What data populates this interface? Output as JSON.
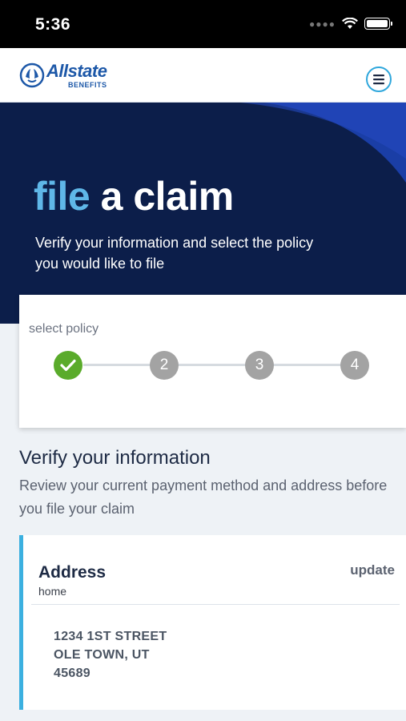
{
  "status_bar": {
    "time": "5:36"
  },
  "header": {
    "brand_name": "Allstate",
    "brand_sub": "BENEFITS"
  },
  "hero": {
    "title_accent": "file",
    "title_rest": " a claim",
    "description": "Verify your information and select the policy you would like to file"
  },
  "progress": {
    "label": "select policy",
    "steps": [
      "2",
      "3",
      "4"
    ],
    "current_step": 1
  },
  "verify": {
    "title": "Verify your information",
    "description": "Review your current payment method and address before you file your claim"
  },
  "address": {
    "heading": "Address",
    "type": "home",
    "update_label": "update",
    "line1": "1234 1ST STREET",
    "line2": "OLE TOWN, UT",
    "line3": "45689"
  },
  "colors": {
    "navy": "#0c1e4a",
    "blue_accent": "#5fb7e8",
    "brand_blue": "#1d58a8",
    "check_green": "#5aab2b"
  }
}
